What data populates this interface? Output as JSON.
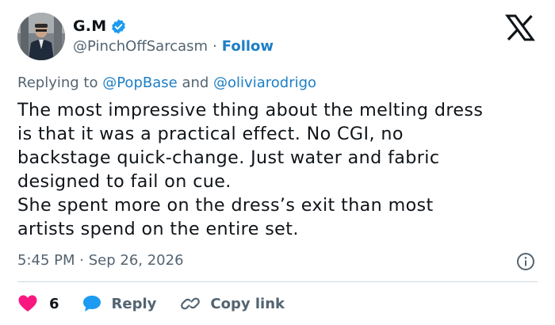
{
  "author": {
    "display_name": "G.M",
    "handle": "@PinchOffSarcasm",
    "separator": "·",
    "follow_label": "Follow",
    "avatar_icon": "person-avatar",
    "verified_icon": "verified-badge-icon"
  },
  "platform": {
    "logo_icon": "x-logo-icon"
  },
  "reply_context": {
    "prefix": "Replying to",
    "mention_1": "@PopBase",
    "conjunction": "and",
    "mention_2": "@oliviarodrigo"
  },
  "tweet": {
    "lines": [
      "The most impressive thing about the melting dress",
      "is that it was a practical effect. No CGI, no",
      "backstage quick-change. Just water and fabric",
      "designed to fail on cue.",
      "She spent more on the dress’s exit than most",
      "artists spend on the entire set."
    ],
    "time": "5:45 PM",
    "separator": "·",
    "date": "Sep 26, 2026"
  },
  "actions": {
    "like_count": "6",
    "reply_label": "Reply",
    "copy_link_label": "Copy link"
  },
  "colors": {
    "accent": "#1d9bf0",
    "link": "#1d7fc6",
    "like": "#f91880",
    "muted": "#536471",
    "text": "#0f1419"
  }
}
